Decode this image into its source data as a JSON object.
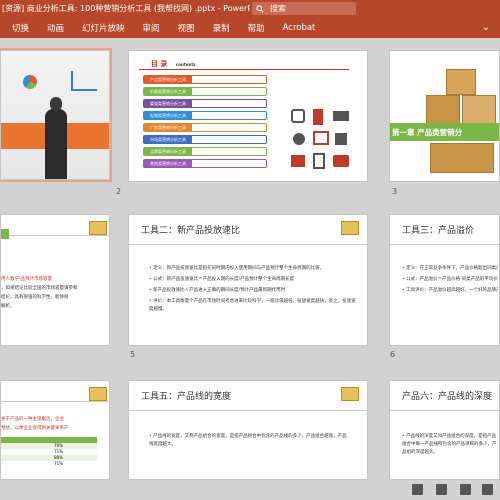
{
  "window": {
    "title": "[资源] 商业分析工具: 100种营销分析工具 (我帮找网) .pptx - PowerPoint",
    "search_placeholder": "搜索"
  },
  "ribbon_tabs": [
    "切换",
    "动画",
    "幻灯片放映",
    "审阅",
    "视图",
    "录制",
    "帮助",
    "Acrobat"
  ],
  "slides": {
    "s2": {
      "number": "2",
      "toc_title": "目 录",
      "toc_sub": "contents",
      "items": [
        "产品类营销分析工具",
        "价格类营销分析工具",
        "渠道类营销分析工具",
        "促销类营销分析工具",
        "广告类营销分析工具",
        "市场类营销分析工具",
        "品牌类营销分析工具",
        "其他类营销分析工具"
      ],
      "colors": [
        "#e25b2b",
        "#7ab648",
        "#7a4fa1",
        "#2f8fd1",
        "#e2872b",
        "#3c6ec7",
        "#7ab648",
        "#9b59b6"
      ]
    },
    "s3": {
      "number": "3",
      "chapter": "第一章  产品类营销分"
    },
    "s4": {
      "lines": [
        "用人数/产品预计市场容量",
        "，如果结论比较全国的市场容量请参和",
        "结论，具有很强的科学性，能够很",
        "解析。"
      ]
    },
    "s5": {
      "number": "5",
      "title": "工具二：新产品投放速比",
      "bullets": [
        "定义：新产品投放速比是指在同时期内投入使用期间与产品预计整个生命周期的比值。",
        "公式：新产品投放速比＝产品投入期的长度/产品预计整个生命周期长度",
        "新产品投放速比＜产品进入正确的期间长度/预计产品最新期代用时",
        "评价：本工具衡量个产品在市场时间考虑进来比较科学，一般比值越低，投放速度越快，反之，投放速度越慢。"
      ]
    },
    "s6": {
      "number": "6",
      "title": "工具三：产品溢价",
      "bullets": [
        "定义：在正常竞争条件下，产品价格超出同类产品的部分，即产品能够因品牌价值而溢价部分。",
        "公式：产品溢价＝产品价格-同类产品的平均价格",
        "工具评价：产品溢价越高越好，一个好的品牌产品会有一个很高的溢价。"
      ]
    },
    "s7": {
      "lines": [
        "关于产品的一种主观概念，企业",
        "预估，以便企业会得到关键关系产"
      ],
      "table": [
        [
          "70%"
        ],
        [
          "71%"
        ],
        [
          "80%"
        ],
        [
          "71%"
        ]
      ]
    },
    "s8": {
      "title": "工具五：产品线的宽度",
      "bullets": [
        "产品线的宽度，又称产品组合的宽度，是指产品组合中包含的产品线的多少，产品组合越宽，产品线宽度越大。"
      ]
    },
    "s9": {
      "title": "产品六：产品线的深度",
      "bullets": [
        "产品线的深度又叫产品组合的深度，是指产品组合中每一产品线所包含的产品项目的多少，产品组的深度越大。"
      ]
    }
  }
}
